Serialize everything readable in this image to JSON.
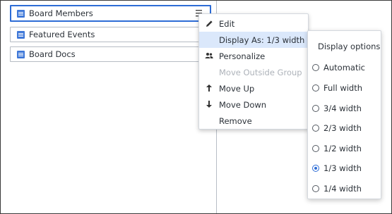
{
  "colors": {
    "accent": "#2d6cd6",
    "widget_icon": "#3f78d8",
    "highlight": "#dbe8fb",
    "disabled": "#aeb3ba"
  },
  "blocks": [
    {
      "label": "Board Members",
      "icon": "widget-list-icon",
      "selected": true
    },
    {
      "label": "Featured Events",
      "icon": "widget-list-icon",
      "selected": false
    },
    {
      "label": "Board Docs",
      "icon": "widget-list-icon",
      "selected": false
    }
  ],
  "context_menu": {
    "items": [
      {
        "label": "Edit",
        "icon": "pencil-icon"
      },
      {
        "label": "Display As: 1/3 width",
        "icon": "",
        "highlighted": true,
        "submenu": true
      },
      {
        "label": "Personalize",
        "icon": "users-icon"
      },
      {
        "label": "Move Outside Group",
        "icon": "",
        "disabled": true
      },
      {
        "label": "Move Up",
        "icon": "arrow-up-icon"
      },
      {
        "label": "Move Down",
        "icon": "arrow-down-icon"
      },
      {
        "label": "Remove",
        "icon": ""
      }
    ]
  },
  "display_options": {
    "title": "Display options",
    "selected": "1/3 width",
    "options": [
      "Automatic",
      "Full width",
      "3/4 width",
      "2/3 width",
      "1/2 width",
      "1/3 width",
      "1/4 width"
    ]
  }
}
